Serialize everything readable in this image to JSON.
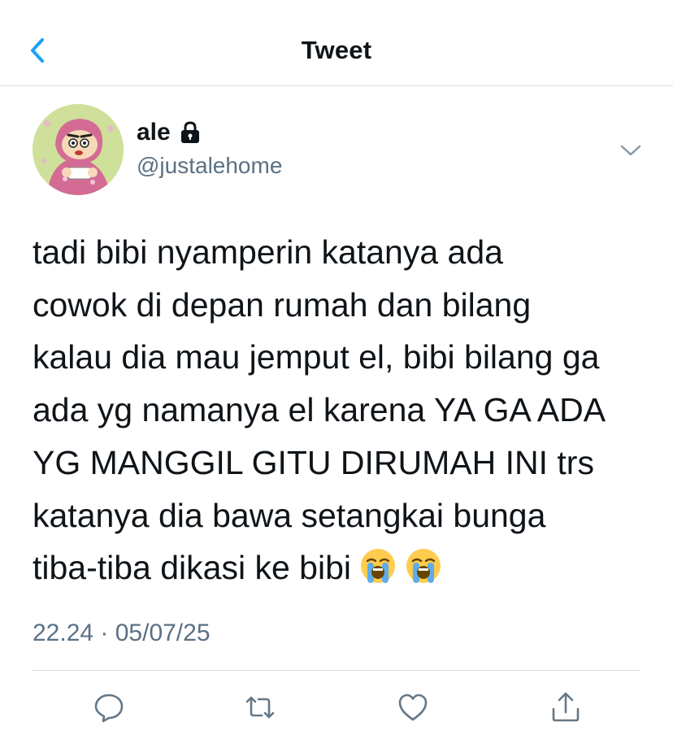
{
  "header": {
    "title": "Tweet",
    "back_icon": "chevron-left-icon"
  },
  "tweet": {
    "display_name": "ale",
    "handle": "@justalehome",
    "protected_icon": "lock-icon",
    "lines": [
      "tadi bibi nyamperin katanya ada",
      "cowok di depan rumah dan bilang",
      "kalau dia mau jemput el, bibi bilang ga",
      "ada yg namanya el karena YA GA ADA",
      "YG MANGGIL GITU DIRUMAH INI trs",
      "katanya dia bawa setangkai bunga",
      "tiba-tiba dikasi ke bibi"
    ],
    "trailing_emojis": [
      "loudly-crying-face",
      "loudly-crying-face"
    ],
    "timestamp": "22.24 · 05/07/25"
  },
  "actions": [
    "reply-icon",
    "retweet-icon",
    "like-icon",
    "share-icon"
  ],
  "colors": {
    "accent": "#1da1f2",
    "text": "#0f1419",
    "secondary": "#5b7083",
    "divider": "#d9dde1"
  }
}
